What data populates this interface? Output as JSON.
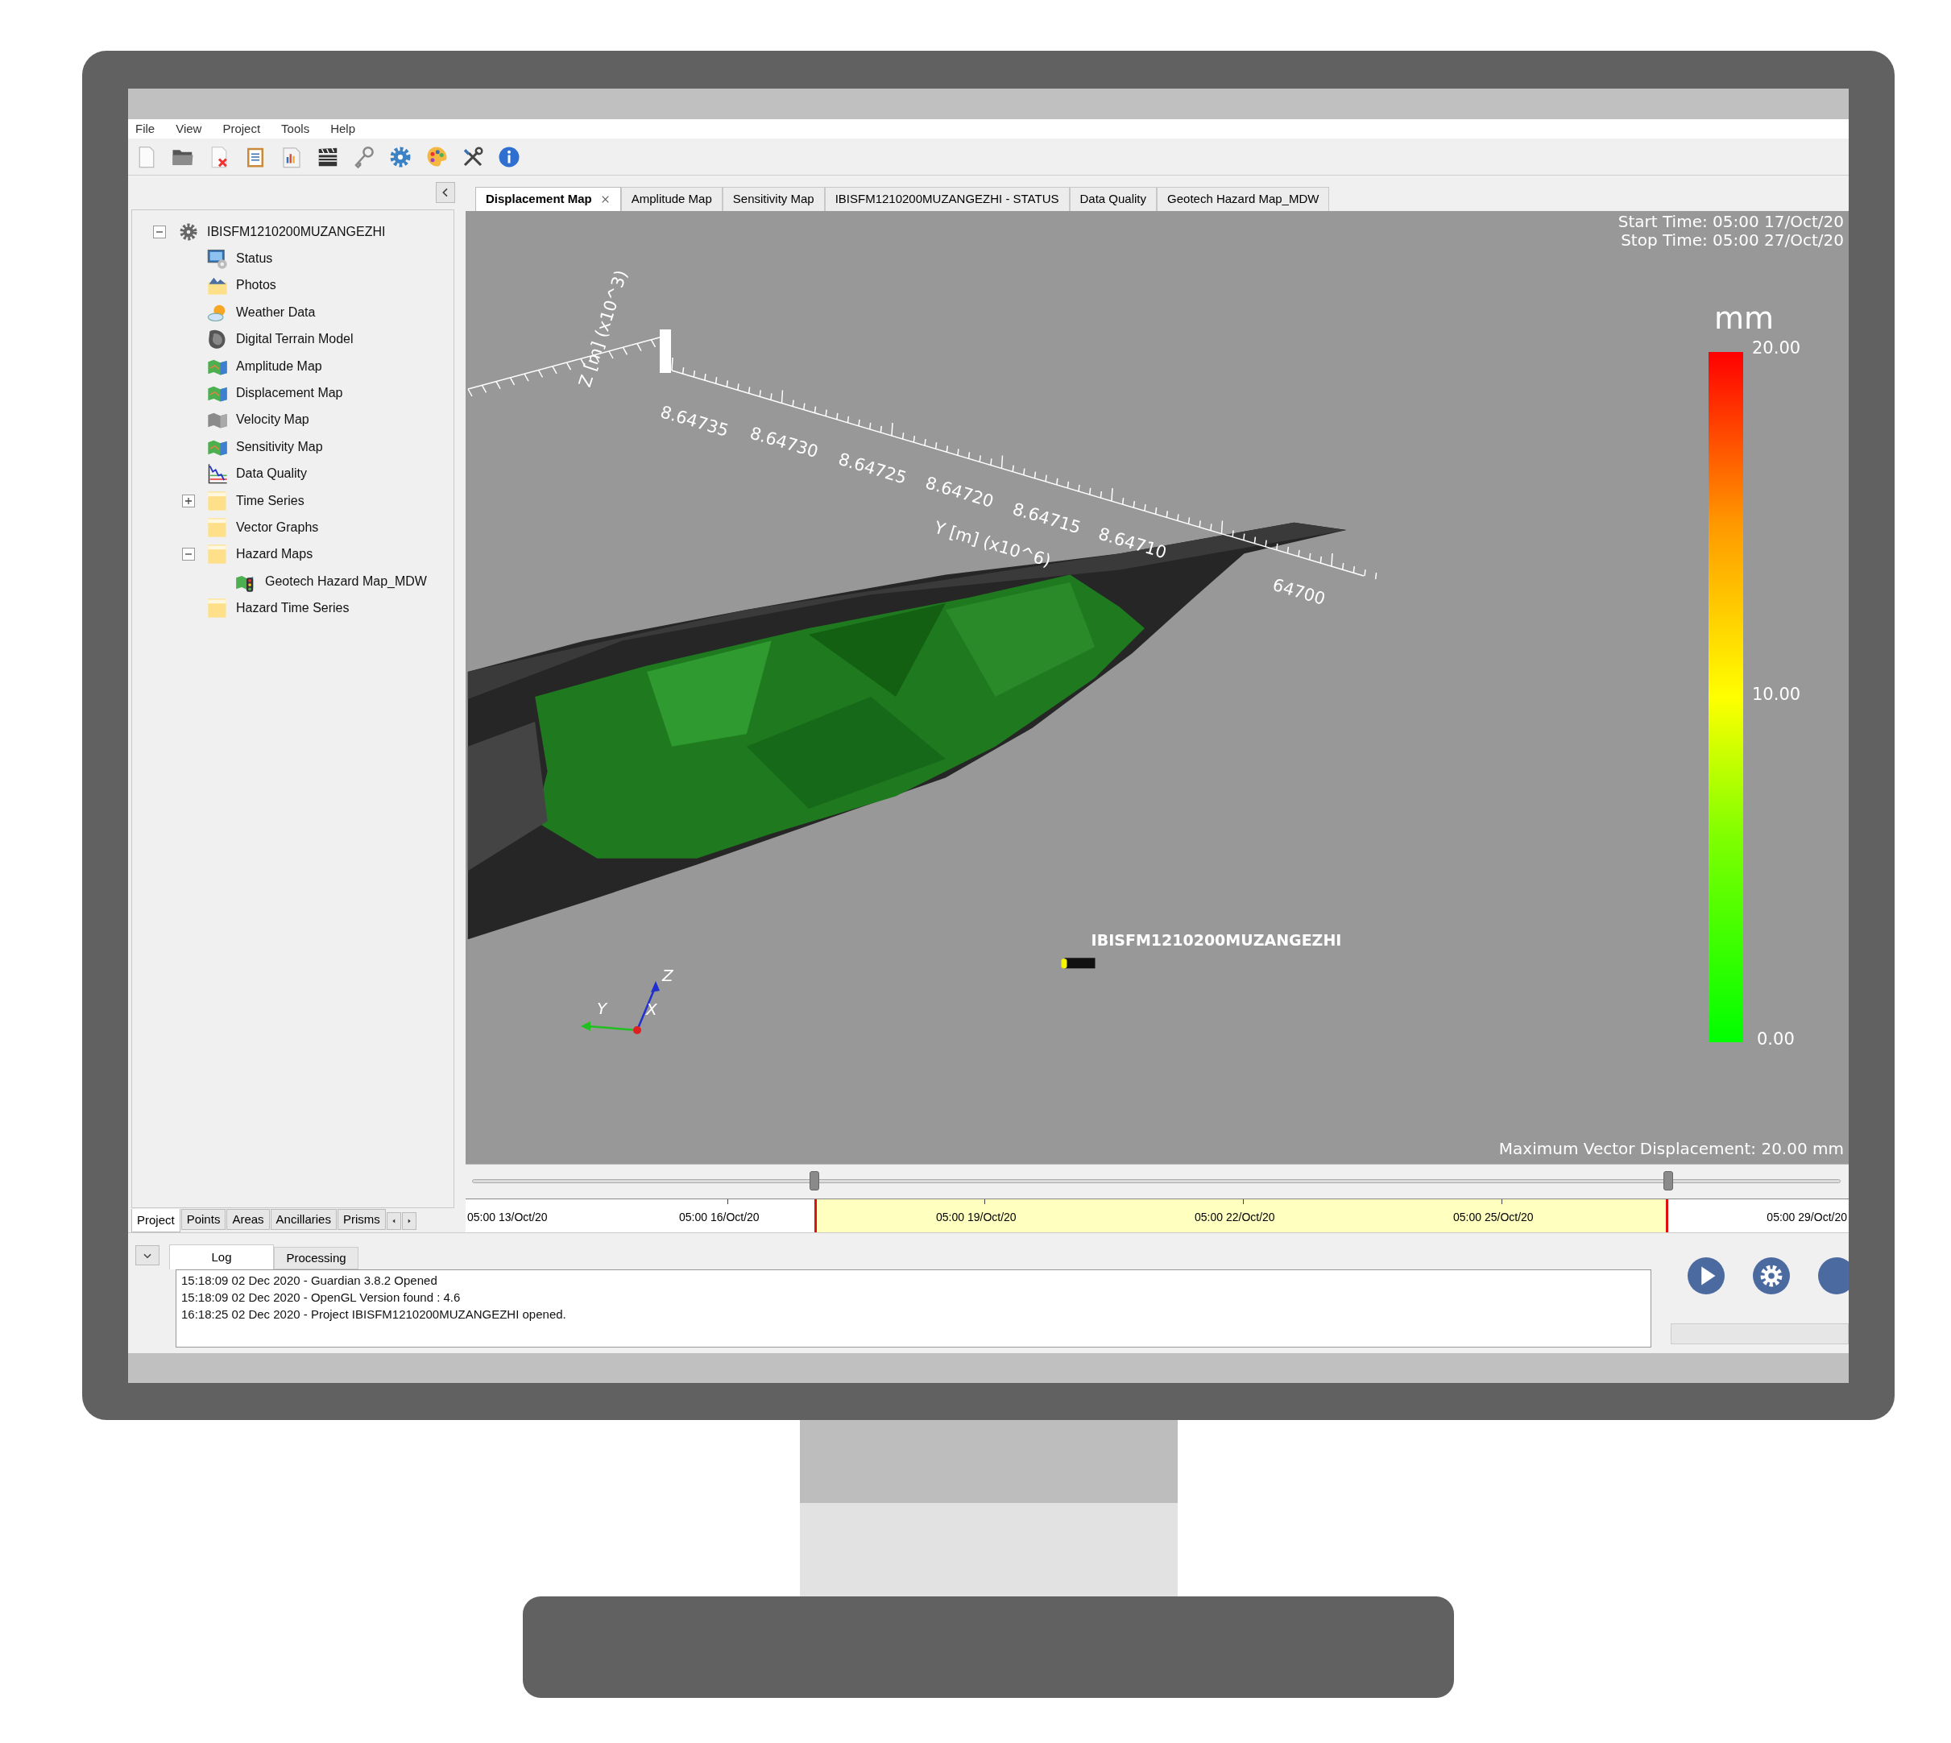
{
  "menu": [
    "File",
    "View",
    "Project",
    "Tools",
    "Help"
  ],
  "tree": {
    "label": "IBISFM1210200MUZANGEZHI",
    "expanded": true,
    "children": [
      {
        "label": "Status",
        "kind": "status"
      },
      {
        "label": "Photos",
        "kind": "photos"
      },
      {
        "label": "Weather Data",
        "kind": "weather"
      },
      {
        "label": "Digital Terrain Model",
        "kind": "terrain"
      },
      {
        "label": "Amplitude Map",
        "kind": "map"
      },
      {
        "label": "Displacement Map",
        "kind": "map"
      },
      {
        "label": "Velocity Map",
        "kind": "gray-map"
      },
      {
        "label": "Sensitivity Map",
        "kind": "map"
      },
      {
        "label": "Data Quality",
        "kind": "chart"
      },
      {
        "label": "Time Series",
        "kind": "folder",
        "expanded": false
      },
      {
        "label": "Vector Graphs",
        "kind": "folder"
      },
      {
        "label": "Hazard Maps",
        "kind": "folder",
        "expanded": true,
        "children": [
          {
            "label": "Geotech Hazard Map_MDW",
            "kind": "hazard-map"
          }
        ]
      },
      {
        "label": "Hazard Time Series",
        "kind": "folder"
      }
    ]
  },
  "panel_tabs": [
    {
      "label": "Project",
      "selected": true
    },
    {
      "label": "Points",
      "selected": false
    },
    {
      "label": "Areas",
      "selected": false
    },
    {
      "label": "Ancillaries",
      "selected": false
    },
    {
      "label": "Prisms",
      "selected": false
    }
  ],
  "document_tabs": [
    {
      "label": "Displacement Map",
      "selected": true,
      "closable": true
    },
    {
      "label": "Amplitude Map",
      "selected": false
    },
    {
      "label": "Sensitivity Map",
      "selected": false
    },
    {
      "label": "IBISFM1210200MUZANGEZHI - STATUS",
      "selected": false
    },
    {
      "label": "Data Quality",
      "selected": false
    },
    {
      "label": "Geotech Hazard Map_MDW",
      "selected": false
    }
  ],
  "view": {
    "start_time": "Start Time: 05:00 17/Oct/20",
    "stop_time": "Stop Time: 05:00 27/Oct/20",
    "z_axis_label": "Z [m] (x10^3)",
    "y_axis_label": "Y [m] (x10^6)",
    "y_ticks": [
      "8.64735",
      "8.64730",
      "8.64725",
      "8.64720",
      "8.64715",
      "8.64710",
      "64700"
    ],
    "marker_label": "IBISFM1210200MUZANGEZHI",
    "triad": [
      "Z",
      "Y",
      "X"
    ],
    "legend": {
      "unit": "mm",
      "labels": [
        "20.00",
        "10.00",
        "0.00"
      ]
    },
    "footer": "Maximum Vector Displacement: 20.00 mm"
  },
  "timeline": {
    "thumbs": [
      {
        "level": 0.25
      },
      {
        "level": 0.874
      }
    ],
    "dates": [
      "05:00 13/Oct/20",
      "05:00 16/Oct/20",
      "05:00 19/Oct/20",
      "05:00 22/Oct/20",
      "05:00 25/Oct/20",
      "05:00 29/Oct/20"
    ]
  },
  "log": {
    "tabs": [
      {
        "label": "Log",
        "selected": true
      },
      {
        "label": "Processing",
        "selected": false
      }
    ],
    "lines": [
      "15:18:09 02 Dec 2020 - Guardian 3.8.2 Opened",
      "15:18:09 02 Dec 2020 - OpenGL Version found : 4.6",
      "16:18:25 02 Dec 2020 - Project IBISFM1210200MUZANGEZHI opened."
    ]
  },
  "progress": {
    "level": 0
  }
}
